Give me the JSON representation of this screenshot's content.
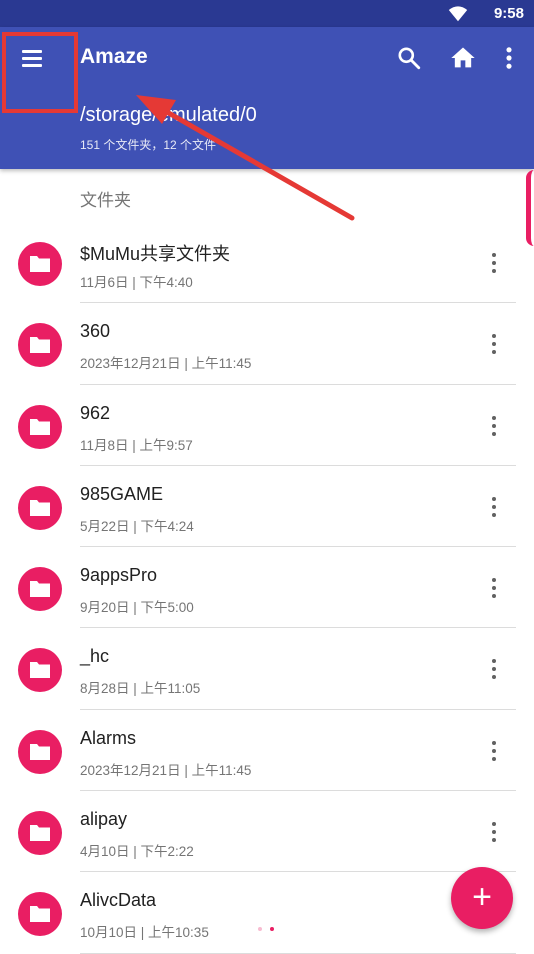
{
  "status_bar": {
    "time": "9:58"
  },
  "app_bar": {
    "title": "Amaze",
    "path": "/storage/emulated/0",
    "summary": "151 个文件夹，12 个文件"
  },
  "section_header": "文件夹",
  "files": [
    {
      "name": "$MuMu共享文件夹",
      "date": "11月6日 | 下午4:40"
    },
    {
      "name": "360",
      "date": "2023年12月21日 | 上午11:45"
    },
    {
      "name": "962",
      "date": "11月8日 | 上午9:57"
    },
    {
      "name": "985GAME",
      "date": "5月22日 | 下午4:24"
    },
    {
      "name": "9appsPro",
      "date": "9月20日 | 下午5:00"
    },
    {
      "name": "_hc",
      "date": "8月28日 | 上午11:05"
    },
    {
      "name": "Alarms",
      "date": "2023年12月21日 | 上午11:45"
    },
    {
      "name": "alipay",
      "date": "4月10日 | 下午2:22"
    },
    {
      "name": "AlivcData",
      "date": "10月10日 | 上午10:35"
    }
  ],
  "fab_label": "+",
  "colors": {
    "status_bar": "#2a3992",
    "app_bar": "#3f51b5",
    "accent": "#e91e63",
    "annotation": "#e53935"
  },
  "icons": [
    "wifi-icon",
    "menu-icon",
    "search-icon",
    "home-icon",
    "more-vert-icon",
    "folder-icon",
    "add-icon"
  ]
}
